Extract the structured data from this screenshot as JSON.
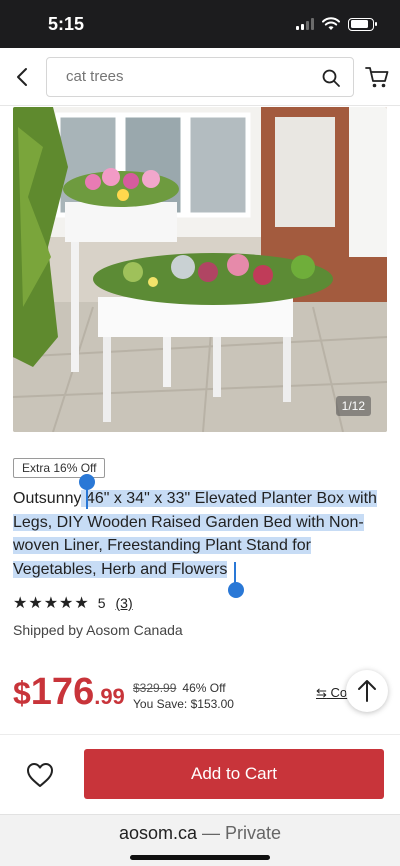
{
  "status_bar": {
    "time": "5:15",
    "battery_level": 0.85
  },
  "search": {
    "placeholder": "cat trees"
  },
  "gallery": {
    "counter": "1/12"
  },
  "product": {
    "promo_badge": "Extra 16% Off",
    "brand": "Outsunny",
    "title_rest": " 46\" x 34\" x 33\" Elevated Planter Box with Legs, DIY Wooden Raised Garden Bed with Non-woven Liner, Freestanding Plant Stand for Vegetables, Herb and Flowers",
    "rating_stars": "★★★★★",
    "rating_value": "5",
    "rating_count": "(3)",
    "shipped_by": "Shipped by Aosom Canada"
  },
  "price": {
    "currency": "$",
    "main": "176",
    "decimal": ".99",
    "old_price": "$329.99",
    "discount": "46% Off",
    "you_save": "You Save: $153.00",
    "compare_label": "Co"
  },
  "actions": {
    "add_to_cart": "Add to Cart"
  },
  "browser": {
    "domain": "aosom.ca",
    "mode": " — Private"
  },
  "colors": {
    "accent": "#c8343a",
    "selection": "#c7dcf5",
    "handle": "#2a78d6"
  }
}
